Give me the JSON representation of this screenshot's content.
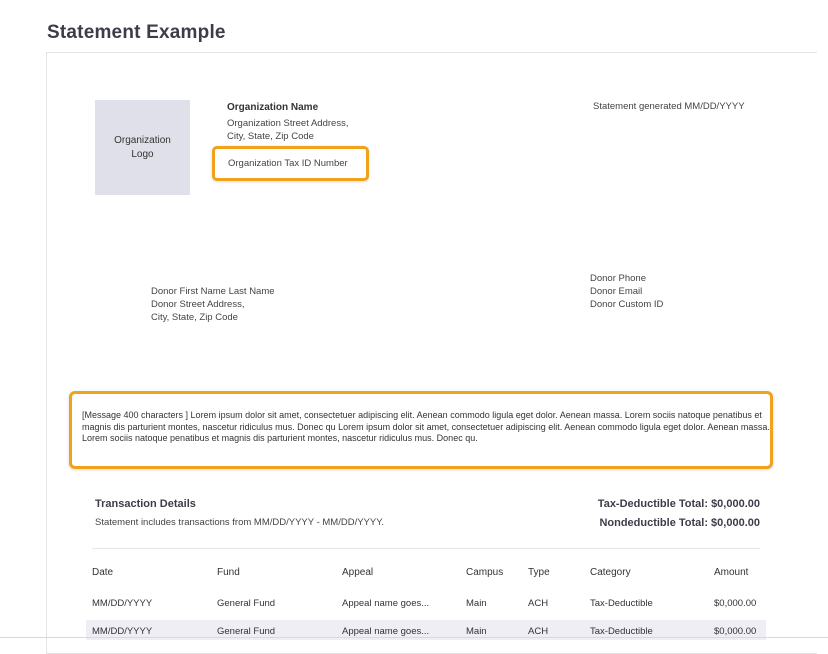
{
  "page_title": "Statement Example",
  "organization": {
    "logo_label": "Organization Logo",
    "name": "Organization Name",
    "address_line1": "Organization Street Address,",
    "address_line2": "City, State, Zip Code",
    "tax_id": "Organization Tax ID Number",
    "statement_generated": "Statement generated MM/DD/YYYY"
  },
  "donor": {
    "name": "Donor First Name Last Name",
    "street": "Donor Street Address,",
    "city": "City, State, Zip Code",
    "phone": "Donor Phone",
    "email": "Donor Email",
    "custom_id": "Donor Custom ID"
  },
  "message": "[Message 400 characters ] Lorem ipsum dolor sit amet, consectetuer adipiscing elit. Aenean commodo ligula eget dolor. Aenean massa. Lorem sociis natoque penatibus et magnis dis parturient montes, nascetur ridiculus mus. Donec qu Lorem ipsum dolor sit amet, consectetuer adipiscing elit. Aenean commodo ligula eget dolor. Aenean massa. Lorem sociis natoque penatibus et magnis dis parturient montes, nascetur ridiculus mus. Donec qu.",
  "transactions": {
    "title": "Transaction Details",
    "subtitle": "Statement includes transactions from MM/DD/YYYY - MM/DD/YYYY.",
    "tax_deductible_total": "Tax-Deductible Total: $0,000.00",
    "nondeductible_total": "Nondeductible Total: $0,000.00",
    "headers": [
      "Date",
      "Fund",
      "Appeal",
      "Campus",
      "Type",
      "Category",
      "Amount"
    ],
    "rows": [
      [
        "MM/DD/YYYY",
        "General Fund",
        "Appeal name goes...",
        "Main",
        "ACH",
        "Tax-Deductible",
        "$0,000.00"
      ],
      [
        "MM/DD/YYYY",
        "General Fund",
        "Appeal name goes...",
        "Main",
        "ACH",
        "Tax-Deductible",
        "$0,000.00"
      ]
    ]
  },
  "colors": {
    "highlight": "#f0a21b",
    "logo_bg": "#dfe0e9",
    "alt_row": "#eeeef4"
  }
}
